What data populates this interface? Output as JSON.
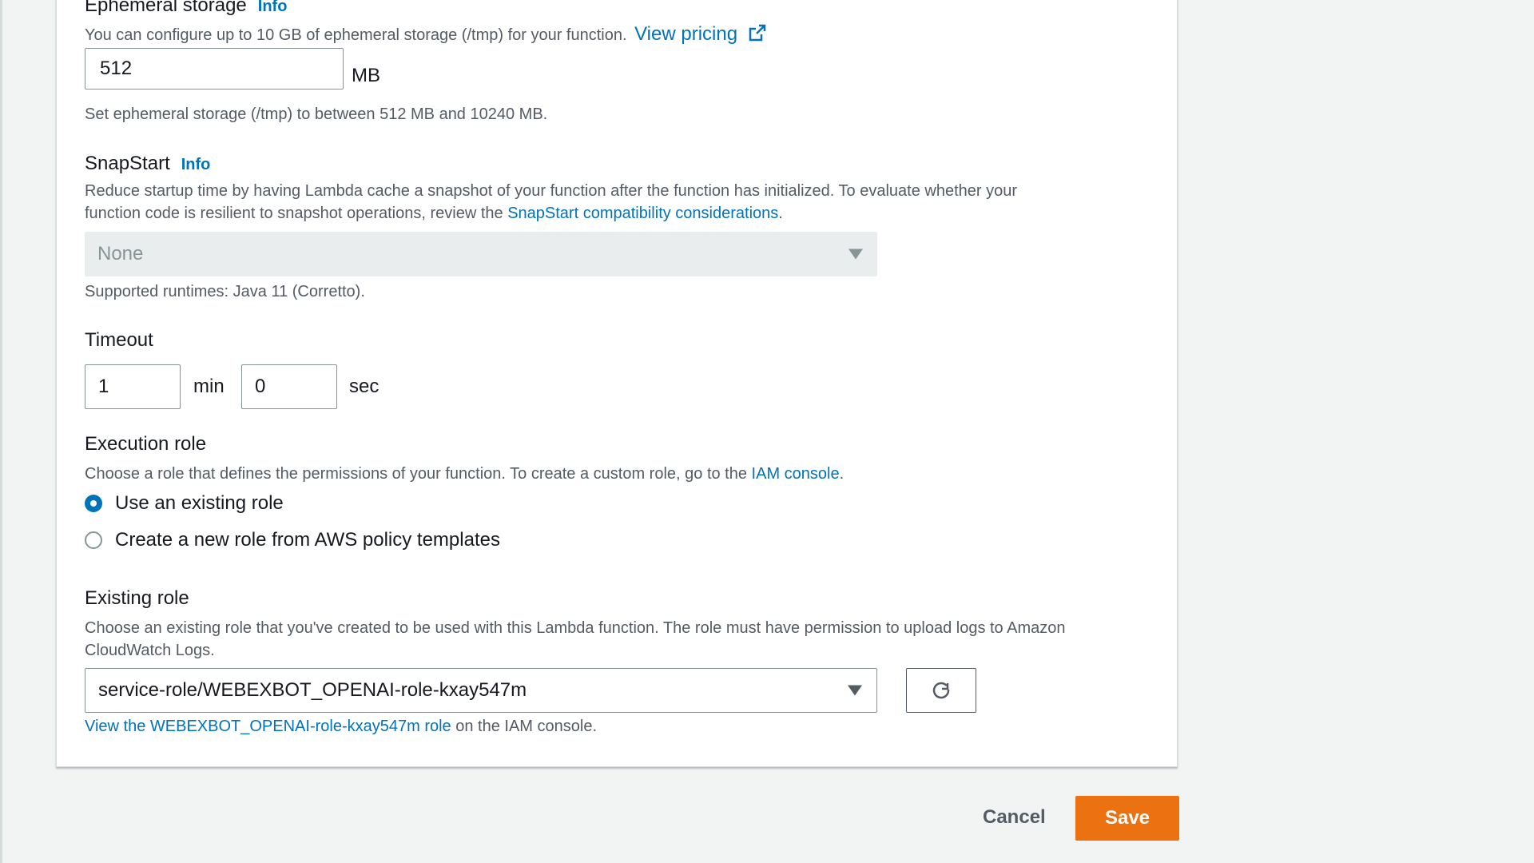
{
  "ephemeral": {
    "label": "Ephemeral storage",
    "info": "Info",
    "desc": "You can configure up to 10 GB of ephemeral storage (/tmp) for your function.",
    "pricing_link": "View pricing",
    "value": "512",
    "unit": "MB",
    "hint": "Set ephemeral storage (/tmp) to between 512 MB and 10240 MB."
  },
  "snapstart": {
    "label": "SnapStart",
    "info": "Info",
    "desc_line1": "Reduce startup time by having Lambda cache a snapshot of your function after the function has initialized. To evaluate whether your",
    "desc_line2_prefix": "function code is resilient to snapshot operations, review the",
    "desc_link": "SnapStart compatibility considerations",
    "desc_suffix": ".",
    "select_value": "None",
    "hint": "Supported runtimes: Java 11 (Corretto)."
  },
  "timeout": {
    "label": "Timeout",
    "min_value": "1",
    "min_unit": "min",
    "sec_value": "0",
    "sec_unit": "sec"
  },
  "execution_role": {
    "label": "Execution role",
    "desc_prefix": "Choose a role that defines the permissions of your function. To create a custom role, go to the",
    "desc_link": "IAM console",
    "desc_suffix": ".",
    "options": [
      {
        "label": "Use an existing role",
        "checked": true
      },
      {
        "label": "Create a new role from AWS policy templates",
        "checked": false
      }
    ]
  },
  "existing_role": {
    "label": "Existing role",
    "desc_line1": "Choose an existing role that you've created to be used with this Lambda function. The role must have permission to upload logs to Amazon",
    "desc_line2": "CloudWatch Logs.",
    "select_value": "service-role/WEBEXBOT_OPENAI-role-kxay547m",
    "view_link": "View the WEBEXBOT_OPENAI-role-kxay547m role",
    "view_suffix": "on the IAM console."
  },
  "footer": {
    "cancel_label": "Cancel",
    "save_label": "Save"
  },
  "colors": {
    "link": "#0073bb",
    "primary_button": "#ec7211",
    "radio_selected": "#0073bb"
  },
  "icons": {
    "external_link": "external-link-icon",
    "dropdown": "caret-down-icon",
    "refresh": "refresh-icon"
  }
}
